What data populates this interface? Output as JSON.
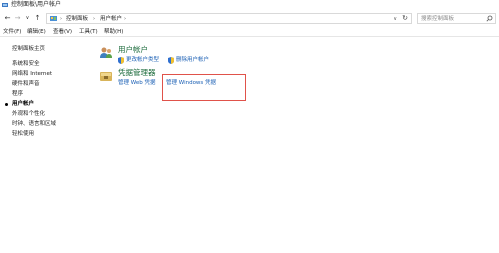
{
  "window": {
    "title": "控制面板\\用户帐户"
  },
  "nav": {
    "back": "←",
    "forward": "→",
    "recent": "∨",
    "up": "↑",
    "breadcrumb": [
      "控制面板",
      "用户帐户"
    ],
    "separator": "›",
    "dropdown": "∨",
    "refresh": "↻",
    "search_placeholder": "搜索控制面板"
  },
  "menu": [
    "文件(F)",
    "编辑(E)",
    "查看(V)",
    "工具(T)",
    "帮助(H)"
  ],
  "sidebar": {
    "home": "控制面板主页",
    "items": [
      "系统和安全",
      "网络和 Internet",
      "硬件和声音",
      "程序",
      "用户帐户",
      "外观和个性化",
      "时钟、语言和区域",
      "轻松使用"
    ],
    "current_index": 4
  },
  "main": {
    "user_accounts": {
      "title": "用户帐户",
      "tasks": [
        "更改帐户类型",
        "删除用户帐户"
      ]
    },
    "credential_manager": {
      "title": "凭据管理器",
      "tasks": [
        "管理 Web 凭据",
        "管理 Windows 凭据"
      ]
    }
  },
  "colors": {
    "link": "#1a5fb4",
    "category_title": "#1a6a3a",
    "highlight": "#e0524a"
  },
  "icons": {
    "app": "control-panel-icon",
    "users": "user-accounts-icon",
    "credentials": "credential-manager-icon",
    "uac": "uac-shield-icon"
  }
}
